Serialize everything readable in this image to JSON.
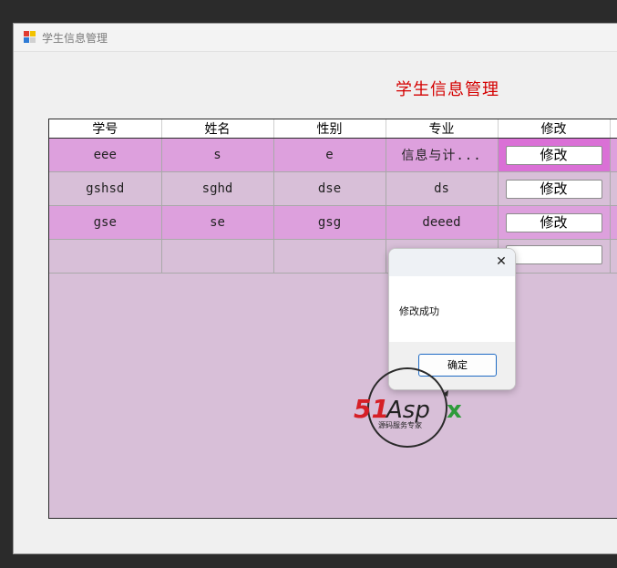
{
  "window": {
    "title": "学生信息管理"
  },
  "form": {
    "title": "学生信息管理"
  },
  "grid": {
    "columns": [
      "学号",
      "姓名",
      "性别",
      "专业",
      "修改"
    ],
    "rows": [
      {
        "id": "eee",
        "name": "s",
        "gender": "e",
        "major": "信息与计...",
        "action": "修改"
      },
      {
        "id": "gshsd",
        "name": "sghd",
        "gender": "dse",
        "major": "ds",
        "action": "修改"
      },
      {
        "id": "gse",
        "name": "se",
        "gender": "gsg",
        "major": "deeed",
        "action": "修改"
      },
      {
        "id": "",
        "name": "",
        "gender": "",
        "major": "",
        "action": ""
      }
    ]
  },
  "dialog": {
    "message": "修改成功",
    "ok_label": "确定",
    "close_icon": "close-icon"
  },
  "watermark": {
    "brand": "51Aspx",
    "tagline": "源码服务专家"
  },
  "colors": {
    "grid_back": "#d8bfd8",
    "alt_row": "#dda0dd",
    "selected_cell": "#da70d6",
    "title_red": "#d40000",
    "ok_border": "#1e6ac4"
  }
}
